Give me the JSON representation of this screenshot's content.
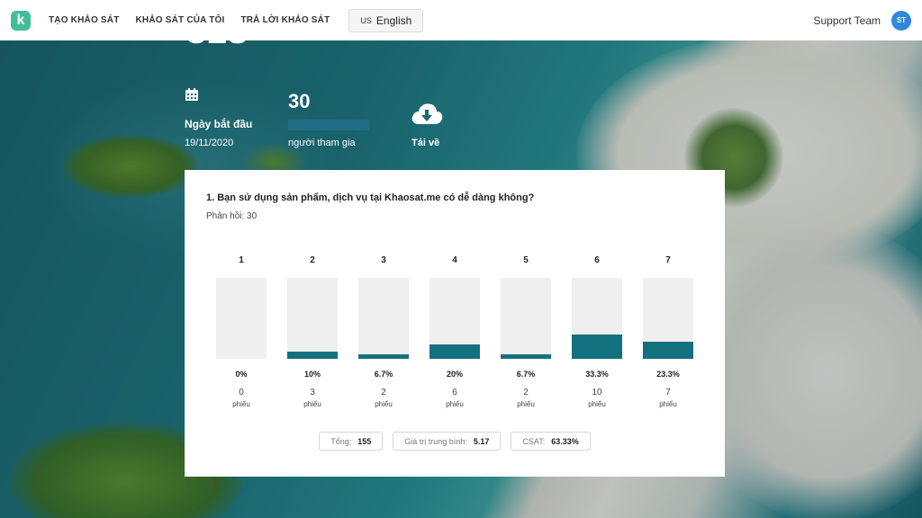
{
  "header": {
    "logo_letter": "k",
    "nav": [
      "TẠO KHẢO SÁT",
      "KHẢO SÁT CỦA TÔI",
      "TRẢ LỜI KHẢO SÁT"
    ],
    "language": {
      "flag": "US",
      "label": "English"
    },
    "support": "Support Team",
    "avatar_initials": "ST"
  },
  "hero": {
    "title": "CES",
    "start_label": "Ngày bắt đầu",
    "start_date": "19/11/2020",
    "participants": "30",
    "participants_label": "người tham gia",
    "download_label": "Tải về"
  },
  "question": {
    "title": "1. Bạn sử dụng sản phẩm, dịch vụ tại Khaosat.me có dễ dàng không?",
    "responses_text": "Phản hồi: 30"
  },
  "chart_data": {
    "type": "bar",
    "categories": [
      "1",
      "2",
      "3",
      "4",
      "5",
      "6",
      "7"
    ],
    "percent_labels": [
      "0%",
      "10%",
      "6.7%",
      "20%",
      "6.7%",
      "33.3%",
      "23.3%"
    ],
    "percent_values": [
      0,
      10,
      6.7,
      20,
      6.7,
      33.3,
      23.3
    ],
    "votes": [
      0,
      3,
      2,
      6,
      2,
      10,
      7
    ],
    "vote_unit": "phiếu",
    "ylim": [
      0,
      100
    ],
    "bar_color": "#13707e",
    "track_color": "#efefef"
  },
  "summary": {
    "total_label": "Tổng:",
    "total_value": "155",
    "avg_label": "Giá trị trung bình:",
    "avg_value": "5.17",
    "csat_label": "CSAT:",
    "csat_value": "63.33%"
  }
}
